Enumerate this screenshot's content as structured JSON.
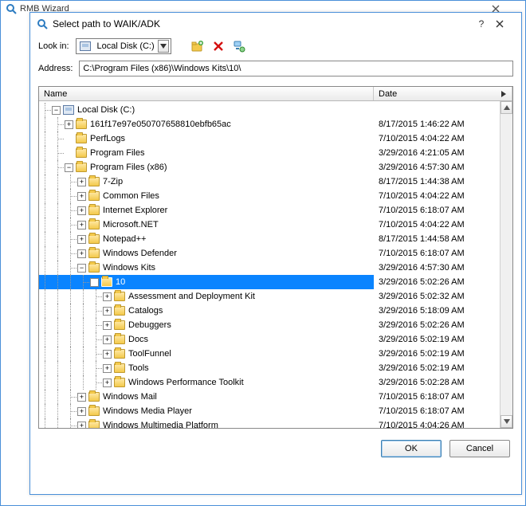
{
  "outer": {
    "title": "RMB Wizard"
  },
  "dialog": {
    "title": "Select path to WAIK/ADK"
  },
  "toolbar": {
    "lookin_label": "Look in:",
    "lookin_value": "Local Disk (C:)"
  },
  "address": {
    "label": "Address:",
    "value": "C:\\Program Files (x86)\\Windows Kits\\10\\"
  },
  "headers": {
    "name": "Name",
    "date": "Date"
  },
  "tree": [
    {
      "depth": 0,
      "expander": "-",
      "icon": "drive",
      "name": "Local Disk (C:)",
      "date": ""
    },
    {
      "depth": 1,
      "expander": "+",
      "icon": "folder",
      "name": "161f17e97e050707658810ebfb65ac",
      "date": "8/17/2015 1:46:22 AM"
    },
    {
      "depth": 1,
      "expander": "",
      "icon": "folder",
      "name": "PerfLogs",
      "date": "7/10/2015 4:04:22 AM"
    },
    {
      "depth": 1,
      "expander": "",
      "icon": "folder",
      "name": "Program Files",
      "date": "3/29/2016 4:21:05 AM"
    },
    {
      "depth": 1,
      "expander": "-",
      "icon": "folder",
      "name": "Program Files (x86)",
      "date": "3/29/2016 4:57:30 AM"
    },
    {
      "depth": 2,
      "expander": "+",
      "icon": "folder",
      "name": "7-Zip",
      "date": "8/17/2015 1:44:38 AM"
    },
    {
      "depth": 2,
      "expander": "+",
      "icon": "folder",
      "name": "Common Files",
      "date": "7/10/2015 4:04:22 AM"
    },
    {
      "depth": 2,
      "expander": "+",
      "icon": "folder",
      "name": "Internet Explorer",
      "date": "7/10/2015 6:18:07 AM"
    },
    {
      "depth": 2,
      "expander": "+",
      "icon": "folder",
      "name": "Microsoft.NET",
      "date": "7/10/2015 4:04:22 AM"
    },
    {
      "depth": 2,
      "expander": "+",
      "icon": "folder",
      "name": "Notepad++",
      "date": "8/17/2015 1:44:58 AM"
    },
    {
      "depth": 2,
      "expander": "+",
      "icon": "folder",
      "name": "Windows Defender",
      "date": "7/10/2015 6:18:07 AM"
    },
    {
      "depth": 2,
      "expander": "-",
      "icon": "folder",
      "name": "Windows Kits",
      "date": "3/29/2016 4:57:30 AM"
    },
    {
      "depth": 3,
      "expander": "-",
      "icon": "folder",
      "name": "10",
      "date": "3/29/2016 5:02:26 AM",
      "selected": true
    },
    {
      "depth": 4,
      "expander": "+",
      "icon": "folder",
      "name": "Assessment and Deployment Kit",
      "date": "3/29/2016 5:02:32 AM"
    },
    {
      "depth": 4,
      "expander": "+",
      "icon": "folder",
      "name": "Catalogs",
      "date": "3/29/2016 5:18:09 AM"
    },
    {
      "depth": 4,
      "expander": "+",
      "icon": "folder",
      "name": "Debuggers",
      "date": "3/29/2016 5:02:26 AM"
    },
    {
      "depth": 4,
      "expander": "+",
      "icon": "folder",
      "name": "Docs",
      "date": "3/29/2016 5:02:19 AM"
    },
    {
      "depth": 4,
      "expander": "+",
      "icon": "folder",
      "name": "ToolFunnel",
      "date": "3/29/2016 5:02:19 AM"
    },
    {
      "depth": 4,
      "expander": "+",
      "icon": "folder",
      "name": "Tools",
      "date": "3/29/2016 5:02:19 AM"
    },
    {
      "depth": 4,
      "expander": "+",
      "icon": "folder",
      "name": "Windows Performance Toolkit",
      "date": "3/29/2016 5:02:28 AM"
    },
    {
      "depth": 2,
      "expander": "+",
      "icon": "folder",
      "name": "Windows Mail",
      "date": "7/10/2015 6:18:07 AM"
    },
    {
      "depth": 2,
      "expander": "+",
      "icon": "folder",
      "name": "Windows Media Player",
      "date": "7/10/2015 6:18:07 AM"
    },
    {
      "depth": 2,
      "expander": "+",
      "icon": "folder",
      "name": "Windows Multimedia Platform",
      "date": "7/10/2015 4:04:26 AM"
    }
  ],
  "buttons": {
    "ok": "OK",
    "cancel": "Cancel"
  },
  "glyphs": {
    "plus": "+",
    "minus": "−"
  }
}
